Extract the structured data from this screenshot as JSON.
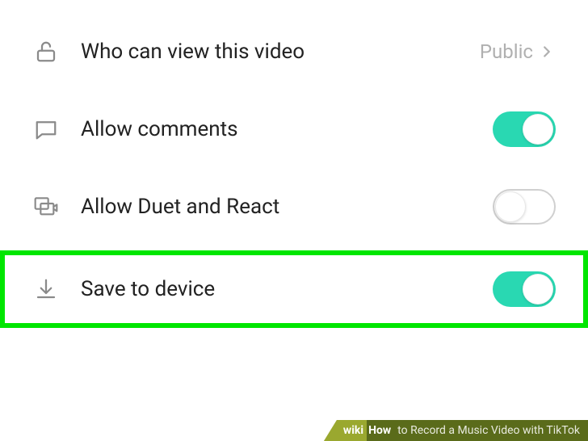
{
  "settings": {
    "privacy": {
      "label": "Who can view this video",
      "value": "Public"
    },
    "comments": {
      "label": "Allow comments",
      "state": "on"
    },
    "duet": {
      "label": "Allow Duet and React",
      "state": "off"
    },
    "save": {
      "label": "Save to device",
      "state": "on"
    }
  },
  "caption": {
    "wiki": "wiki",
    "how": "How",
    "title": " to Record a Music Video with TikTok"
  }
}
